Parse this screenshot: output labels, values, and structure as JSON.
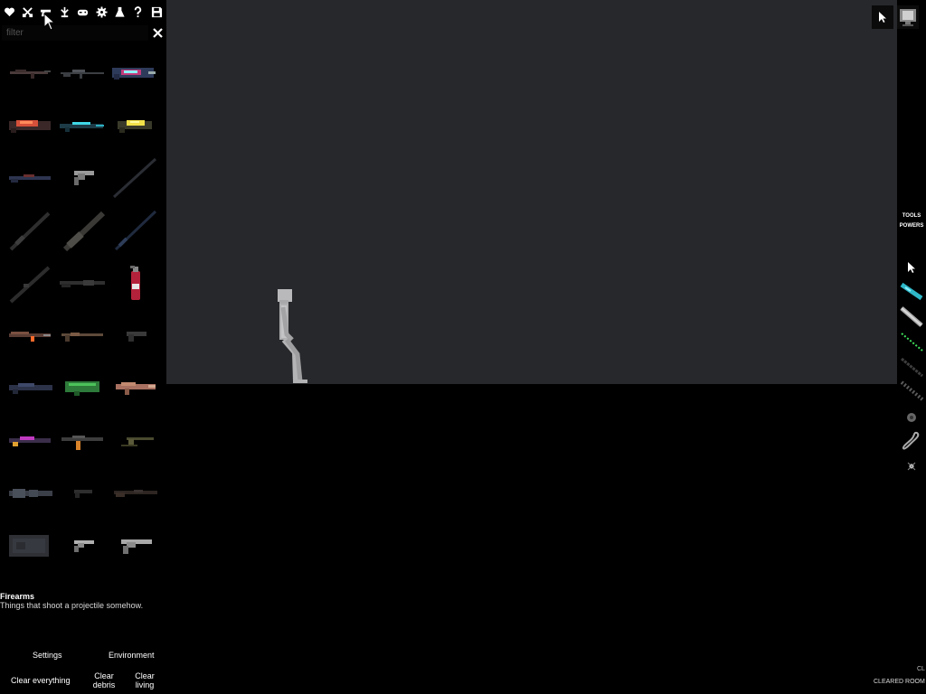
{
  "toolbar": {
    "buttons": [
      {
        "name": "heart-icon"
      },
      {
        "name": "swords-icon"
      },
      {
        "name": "gun-icon"
      },
      {
        "name": "plant-icon"
      },
      {
        "name": "gamepad-icon"
      },
      {
        "name": "gear-icon"
      },
      {
        "name": "flask-icon"
      },
      {
        "name": "question-icon"
      },
      {
        "name": "save-icon"
      }
    ]
  },
  "filter": {
    "placeholder": "filter",
    "value": ""
  },
  "category": {
    "title": "Firearms",
    "description": "Things that shoot a projectile somehow."
  },
  "items": [
    {
      "icon": "assault-rifle-icon",
      "label": ""
    },
    {
      "icon": "sniper-rifle-icon",
      "label": ""
    },
    {
      "icon": "digital-launcher-icon",
      "label": ""
    },
    {
      "icon": "red-energy-cannon-icon",
      "label": ""
    },
    {
      "icon": "cyan-laser-rifle-icon",
      "label": ""
    },
    {
      "icon": "yellow-energy-gun-icon",
      "label": ""
    },
    {
      "icon": "shotgun-icon",
      "label": ""
    },
    {
      "icon": "revolver-icon",
      "label": ""
    },
    {
      "icon": "long-barrel-icon",
      "label": ""
    },
    {
      "icon": "rocket-tube-icon",
      "label": ""
    },
    {
      "icon": "minigun-icon",
      "label": ""
    },
    {
      "icon": "rail-barrel-icon",
      "label": ""
    },
    {
      "icon": "bazooka-icon",
      "label": ""
    },
    {
      "icon": "pump-shotgun-icon",
      "label": ""
    },
    {
      "icon": "fire-extinguisher-icon",
      "label": ""
    },
    {
      "icon": "gatling-icon",
      "label": ""
    },
    {
      "icon": "musket-icon",
      "label": ""
    },
    {
      "icon": "pistol-icon",
      "label": ""
    },
    {
      "icon": "plasma-rifle-icon",
      "label": ""
    },
    {
      "icon": "green-blaster-icon",
      "label": ""
    },
    {
      "icon": "flamethrower-icon",
      "label": ""
    },
    {
      "icon": "pink-grenade-launcher-icon",
      "label": ""
    },
    {
      "icon": "smg-icon",
      "label": ""
    },
    {
      "icon": "mounted-turret-icon",
      "label": ""
    },
    {
      "icon": "heavy-cannon-icon",
      "label": ""
    },
    {
      "icon": "small-pistol-icon",
      "label": ""
    },
    {
      "icon": "dark-rifle-icon",
      "label": ""
    },
    {
      "icon": "armored-box-icon",
      "label": ""
    },
    {
      "icon": "silver-revolver-icon",
      "label": ""
    },
    {
      "icon": "magnum-revolver-icon",
      "label": ""
    }
  ],
  "sidebar_buttons": {
    "settings": "Settings",
    "environment": "Environment",
    "clear_everything": "Clear everything",
    "clear_debris": "Clear debris",
    "clear_living": "Clear living"
  },
  "right_toolbar": {
    "tools_tab": "TOOLS",
    "powers_tab": "POWERS",
    "tools": [
      {
        "name": "pointer-tool-icon"
      },
      {
        "name": "cyan-gun-tool-icon"
      },
      {
        "name": "pipe-tool-icon"
      },
      {
        "name": "green-wire-tool-icon"
      },
      {
        "name": "gray-rod-tool-icon"
      },
      {
        "name": "spring-tool-icon"
      },
      {
        "name": "gear-tool-icon"
      },
      {
        "name": "rope-tool-icon"
      },
      {
        "name": "pin-tool-icon"
      }
    ]
  },
  "top_right": {
    "buttons": [
      {
        "name": "cursor-mode-icon"
      },
      {
        "name": "monitor-icon"
      }
    ]
  },
  "status": {
    "text": "CLEARED ROOM",
    "corner": "CL"
  },
  "colors": {
    "world_background": "#27282b",
    "ground": "#000000",
    "ragdoll": "#b9b9bb"
  }
}
